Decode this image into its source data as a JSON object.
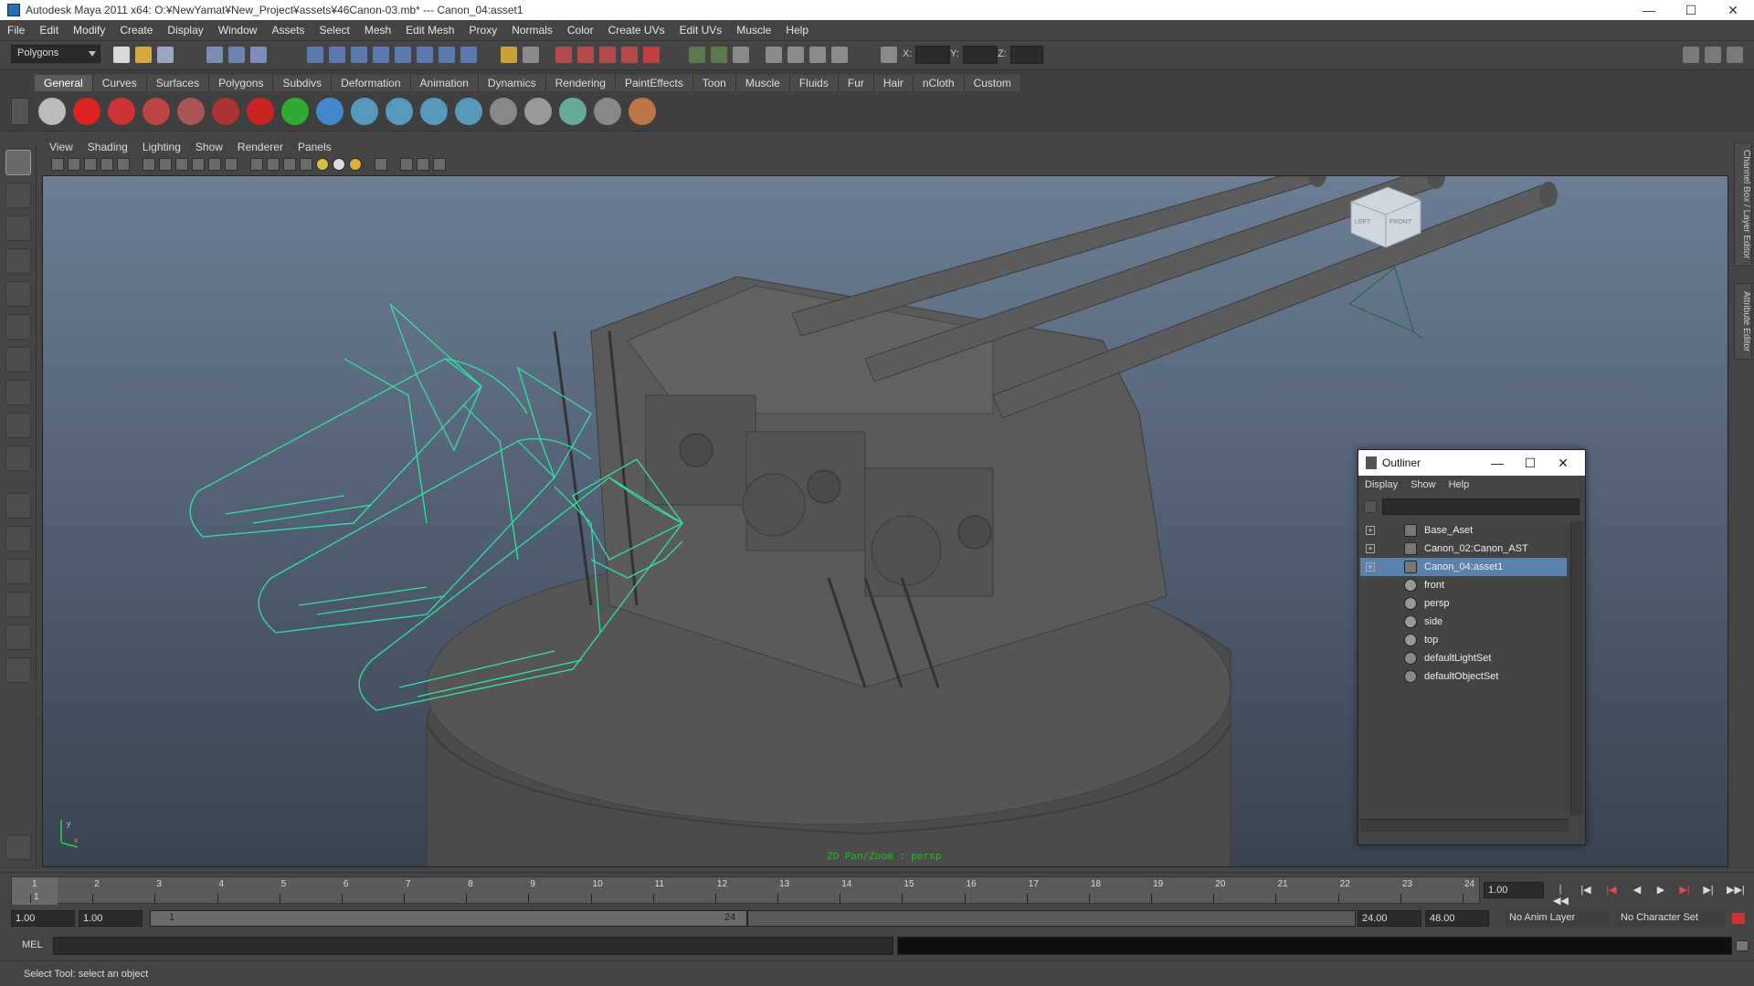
{
  "window": {
    "title": "Autodesk Maya 2011 x64: O:¥NewYamat¥New_Project¥assets¥46Canon-03.mb*   ---   Canon_04:asset1",
    "minimize": "—",
    "maximize": "☐",
    "close": "✕"
  },
  "menubar": [
    "File",
    "Edit",
    "Modify",
    "Create",
    "Display",
    "Window",
    "Assets",
    "Select",
    "Mesh",
    "Edit Mesh",
    "Proxy",
    "Normals",
    "Color",
    "Create UVs",
    "Edit UVs",
    "Muscle",
    "Help"
  ],
  "statusline": {
    "mode": "Polygons",
    "x_label": "X:",
    "y_label": "Y:",
    "z_label": "Z:"
  },
  "shelf": {
    "tabs": [
      "General",
      "Curves",
      "Surfaces",
      "Polygons",
      "Subdivs",
      "Deformation",
      "Animation",
      "Dynamics",
      "Rendering",
      "PaintEffects",
      "Toon",
      "Muscle",
      "Fluids",
      "Fur",
      "Hair",
      "nCloth",
      "Custom"
    ],
    "active_tab": "General"
  },
  "panel_menu": [
    "View",
    "Shading",
    "Lighting",
    "Show",
    "Renderer",
    "Panels"
  ],
  "viewport": {
    "status": "2D Pan/Zoom : persp",
    "viewcube_left": "LEFT",
    "viewcube_front": "FRONT",
    "axis_x": "x",
    "axis_y": "y"
  },
  "side_tabs": [
    "Channel Box / Layer Editor",
    "Attribute Editor"
  ],
  "outliner": {
    "title": "Outliner",
    "menu": [
      "Display",
      "Show",
      "Help"
    ],
    "items": [
      {
        "label": "Base_Aset",
        "kind": "group",
        "expandable": true,
        "selected": false
      },
      {
        "label": "Canon_02:Canon_AST",
        "kind": "group",
        "expandable": true,
        "selected": false
      },
      {
        "label": "Canon_04:asset1",
        "kind": "group",
        "expandable": true,
        "selected": true
      },
      {
        "label": "front",
        "kind": "camera",
        "expandable": false,
        "selected": false
      },
      {
        "label": "persp",
        "kind": "camera",
        "expandable": false,
        "selected": false
      },
      {
        "label": "side",
        "kind": "camera",
        "expandable": false,
        "selected": false
      },
      {
        "label": "top",
        "kind": "camera",
        "expandable": false,
        "selected": false
      },
      {
        "label": "defaultLightSet",
        "kind": "set",
        "expandable": false,
        "selected": false
      },
      {
        "label": "defaultObjectSet",
        "kind": "set",
        "expandable": false,
        "selected": false
      }
    ]
  },
  "timeslider": {
    "frames": [
      "1",
      "2",
      "3",
      "4",
      "5",
      "6",
      "7",
      "8",
      "9",
      "10",
      "11",
      "12",
      "13",
      "14",
      "15",
      "16",
      "17",
      "18",
      "19",
      "20",
      "21",
      "22",
      "23",
      "24"
    ],
    "current_frame": "1",
    "current_time": "1.00"
  },
  "rangeslider": {
    "anim_start": "1.00",
    "playback_start": "1.00",
    "range_start": "1",
    "range_end": "24",
    "playback_end": "24.00",
    "anim_end": "48.00",
    "anim_layer": "No Anim Layer",
    "character_set": "No Character Set"
  },
  "cmdline": {
    "label": "MEL"
  },
  "helpline": {
    "text": "Select Tool: select an object"
  },
  "colors": {
    "wireframe": "#34e0a1",
    "selection": "#5b82ab",
    "status_green": "#1bc41b"
  }
}
